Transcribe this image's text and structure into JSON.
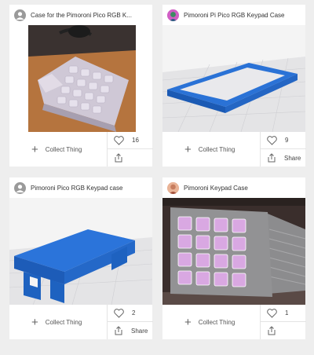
{
  "cards": [
    {
      "title": "Case for the Pimoroni Pico RGB K...",
      "collect_label": "Collect Thing",
      "likes": "16",
      "share_label": "",
      "avatar": "default-user-icon"
    },
    {
      "title": "Pimoroni Pi Pico RGB Keypad Case",
      "collect_label": "Collect Thing",
      "likes": "9",
      "share_label": "Share",
      "avatar": "user-avatar"
    },
    {
      "title": "Pimoroni Pico RGB Keypad case",
      "collect_label": "Collect Thing",
      "likes": "2",
      "share_label": "Share",
      "avatar": "default-user-icon"
    },
    {
      "title": "Pimoroni Keypad Case",
      "collect_label": "Collect Thing",
      "likes": "1",
      "share_label": "",
      "avatar": "user-avatar"
    }
  ],
  "colors": {
    "accent_blue": "#1f6fd0",
    "background": "#eeeeee",
    "card": "#ffffff"
  }
}
